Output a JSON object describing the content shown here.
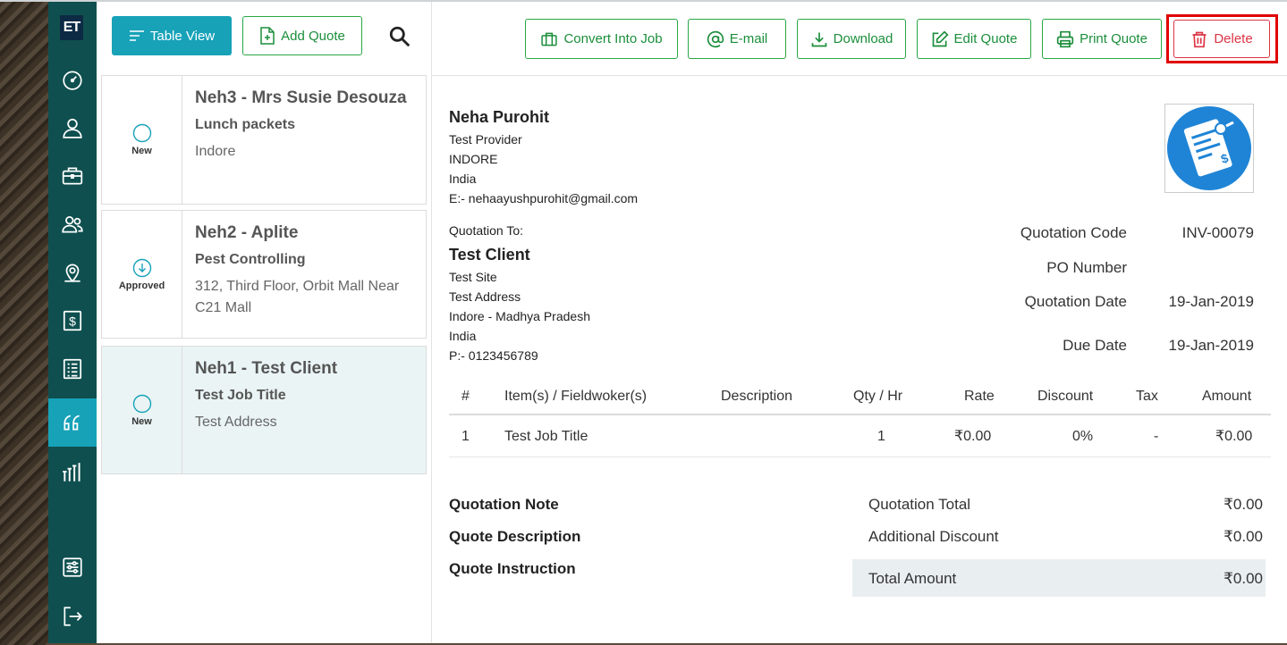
{
  "sidebar": {
    "logo": "ET",
    "items": [
      {
        "name": "dashboard-icon"
      },
      {
        "name": "user-icon"
      },
      {
        "name": "briefcase-icon"
      },
      {
        "name": "users-icon"
      },
      {
        "name": "map-pin-icon"
      },
      {
        "name": "dollar-icon"
      },
      {
        "name": "list-icon"
      },
      {
        "name": "quote-icon",
        "active": true
      },
      {
        "name": "reports-icon"
      },
      {
        "name": "settings-icon"
      },
      {
        "name": "logout-icon"
      }
    ]
  },
  "list": {
    "table_view_label": "Table View",
    "add_quote_label": "Add Quote",
    "cards": [
      {
        "status": "New",
        "title": "Neh3 - Mrs Susie Desouza",
        "subtitle": "Lunch packets",
        "address": "Indore"
      },
      {
        "status": "Approved",
        "title": "Neh2 - Aplite",
        "subtitle": "Pest Controlling",
        "address": "312, Third Floor, Orbit Mall Near C21 Mall"
      },
      {
        "status": "New",
        "title": "Neh1 - Test Client",
        "subtitle": "Test Job Title",
        "address": "Test Address"
      }
    ]
  },
  "toolbar": {
    "convert": "Convert Into Job",
    "email": "E-mail",
    "download": "Download",
    "edit": "Edit Quote",
    "print": "Print Quote",
    "delete": "Delete"
  },
  "provider": {
    "name": "Neha Purohit",
    "line1": "Test Provider",
    "line2": "INDORE",
    "line3": "India",
    "email": "E:- nehaayushpurohit@gmail.com"
  },
  "client": {
    "heading": "Quotation To:",
    "name": "Test Client",
    "line1": "Test Site",
    "line2": "Test Address",
    "line3": "Indore - Madhya Pradesh",
    "line4": "India",
    "phone": "P:- 0123456789"
  },
  "meta": {
    "code_label": "Quotation Code",
    "code_value": "INV-00079",
    "po_label": "PO Number",
    "po_value": "",
    "date_label": "Quotation Date",
    "date_value": "19-Jan-2019",
    "due_label": "Due Date",
    "due_value": "19-Jan-2019"
  },
  "table": {
    "headers": [
      "#",
      "Item(s) / Fieldwoker(s)",
      "Description",
      "Qty / Hr",
      "Rate",
      "Discount",
      "Tax",
      "Amount"
    ],
    "rows": [
      [
        "1",
        "Test Job Title",
        "",
        "1",
        "₹0.00",
        "0%",
        "-",
        "₹0.00"
      ]
    ]
  },
  "footer": {
    "note": "Quotation Note",
    "description": "Quote Description",
    "instruction": "Quote Instruction",
    "total_label": "Quotation Total",
    "total_value": "₹0.00",
    "discount_label": "Additional Discount",
    "discount_value": "₹0.00",
    "amount_label": "Total Amount",
    "amount_value": "₹0.00"
  },
  "colors": {
    "sidebar_bg": "#0f4f4f",
    "accent": "#17a2b8",
    "success": "#28a745",
    "danger": "#dc3545",
    "highlight": "#e00000"
  }
}
